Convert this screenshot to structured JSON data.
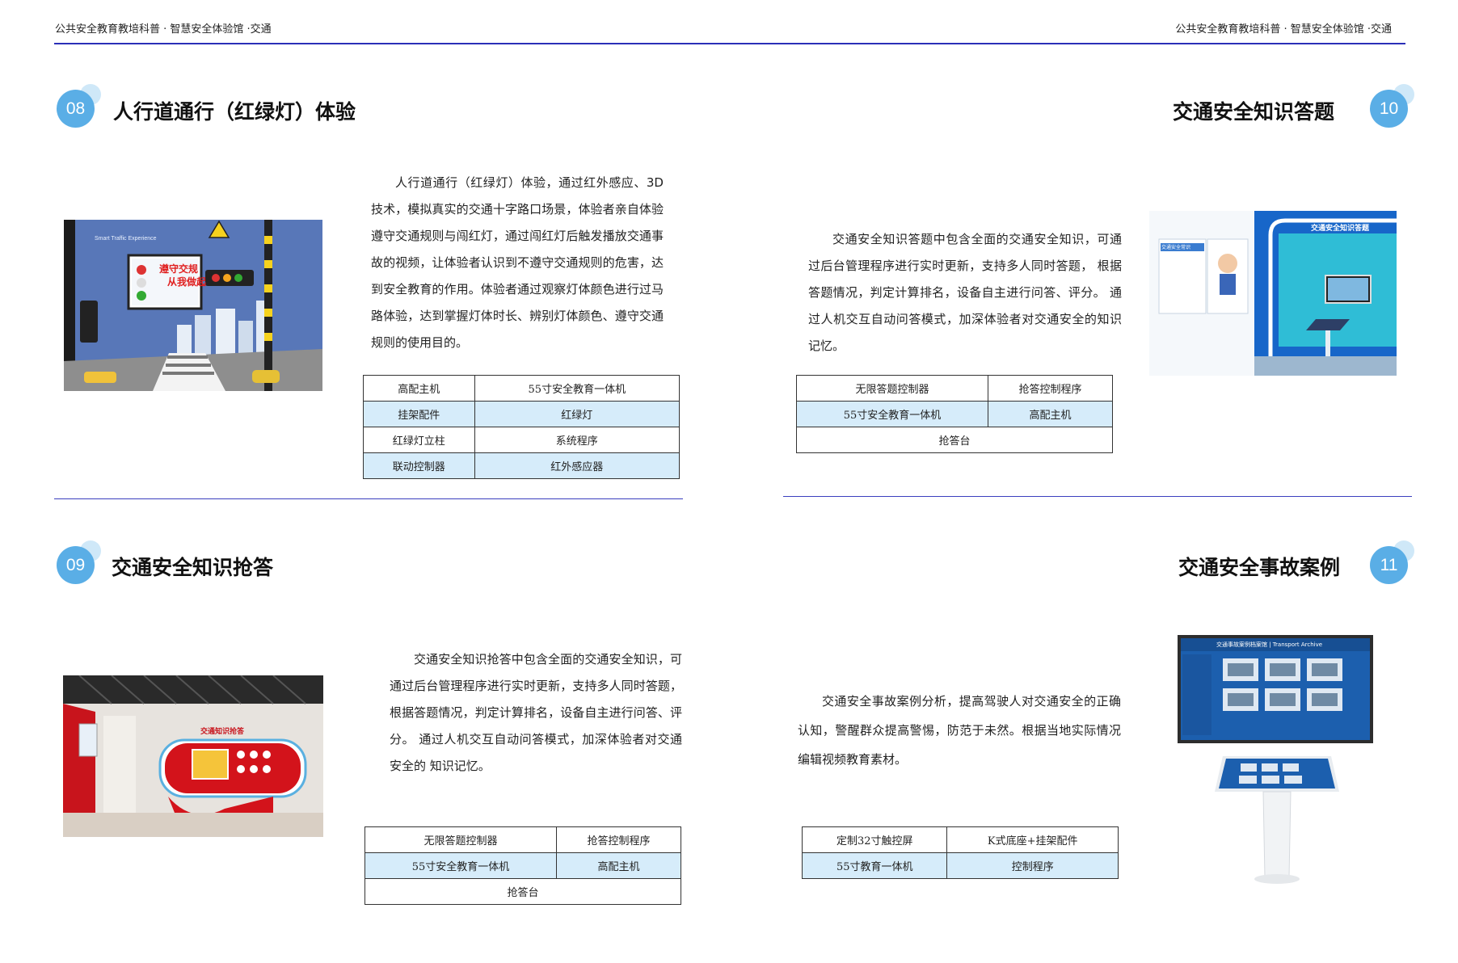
{
  "header": {
    "left": "公共安全教育教培科普  ·  智慧安全体验馆  ·交通",
    "right": "公共安全教育教培科普  ·  智慧安全体验馆  ·交通"
  },
  "sections": {
    "s08": {
      "number": "08",
      "title": "人行道通行（红绿灯）体验",
      "description": "人行道通行（红绿灯）体验，通过红外感应、3D技术，模拟真实的交通十字路口场景，体验者亲自体验遵守交通规则与闯红灯，通过闯红灯后触发播放交通事故的视频，让体验者认识到不遵守交通规则的危害，达到安全教育的作用。体验者通过观察灯体颜色进行过马路体验，达到掌握灯体时长、辨别灯体颜色、遵守交通规则的使用目的。",
      "image_text": {
        "sign1": "遵守交规",
        "sign2": "从我做起",
        "banner": "Smart Traffic Experience"
      },
      "table": [
        [
          "高配主机",
          "55寸安全教育一体机"
        ],
        [
          "挂架配件",
          "红绿灯"
        ],
        [
          "红绿灯立柱",
          "系统程序"
        ],
        [
          "联动控制器",
          "红外感应器"
        ]
      ]
    },
    "s10": {
      "number": "10",
      "title": "交通安全知识答题",
      "description": "交通安全知识答题中包含全面的交通安全知识，可通过后台管理程序进行实时更新，支持多人同时答题，  根据答题情况，判定计算排名，设备自主进行问答、评分。  通过人机交互自动问答模式，加深体验者对交通安全的知识记忆。",
      "image_text": {
        "wall": "交通安全知识答题",
        "poster": "交通安全常识"
      },
      "table": [
        [
          "无限答题控制器",
          "抢答控制程序"
        ],
        [
          "55寸安全教育一体机",
          "高配主机"
        ],
        [
          "抢答台"
        ]
      ]
    },
    "s09": {
      "number": "09",
      "title": "交通安全知识抢答",
      "description": "交通安全知识抢答中包含全面的交通安全知识，可通过后台管理程序进行实时更新，支持多人同时答题，  根据答题情况，判定计算排名，设备自主进行问答、评分。  通过人机交互自动问答模式，加深体验者对交通安全的  知识记忆。",
      "image_text": {
        "wall": "交通知识抢答"
      },
      "table": [
        [
          "无限答题控制器",
          "抢答控制程序"
        ],
        [
          "55寸安全教育一体机",
          "高配主机"
        ],
        [
          "抢答台"
        ]
      ]
    },
    "s11": {
      "number": "11",
      "title": "交通安全事故案例",
      "description": "交通安全事故案例分析，提高驾驶人对交通安全的正确认知，警醒群众提高警惕，防范于未然。根据当地实际情况编辑视频教育素材。",
      "image_text": {
        "screen_title": "交通事故案例档案馆 | Transport Archive"
      },
      "table": [
        [
          "定制32寸触控屏",
          "K式底座+挂架配件"
        ],
        [
          "55寸教育一体机",
          "控制程序"
        ]
      ]
    }
  },
  "colors": {
    "accent_blue": "#2b2fb8",
    "badge_blue": "#5aaee6",
    "table_alt": "#d6ecfa"
  }
}
